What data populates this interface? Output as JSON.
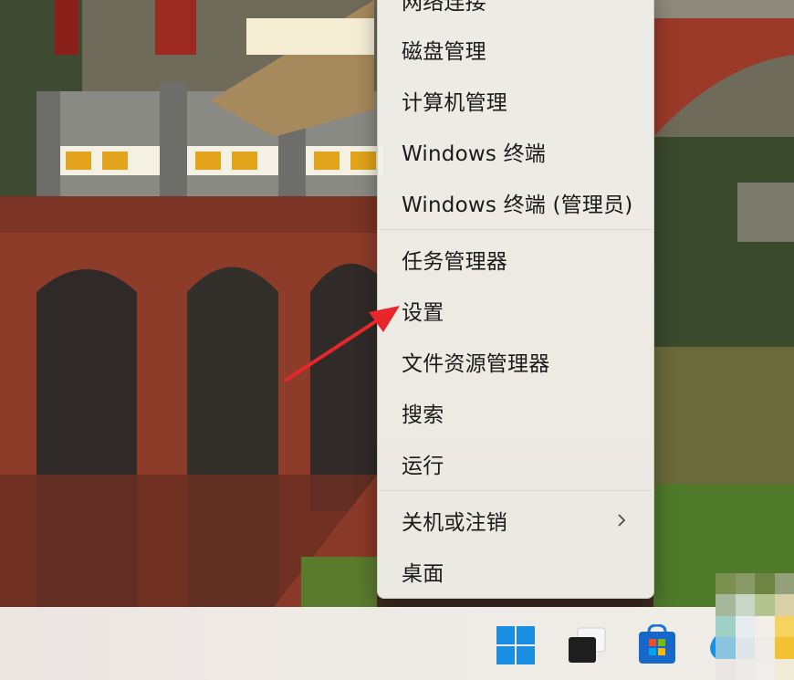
{
  "context_menu": {
    "items": [
      {
        "label": "网络连接"
      },
      {
        "label": "磁盘管理"
      },
      {
        "label": "计算机管理"
      },
      {
        "label": "Windows 终端"
      },
      {
        "label": "Windows 终端 (管理员)"
      },
      {
        "label": "任务管理器"
      },
      {
        "label": "设置"
      },
      {
        "label": "文件资源管理器"
      },
      {
        "label": "搜索"
      },
      {
        "label": "运行"
      },
      {
        "label": "关机或注销",
        "has_submenu": true
      },
      {
        "label": "桌面"
      }
    ]
  },
  "annotation": {
    "color": "#e8272a",
    "points_to": "设置"
  },
  "taskbar": {
    "icons": [
      "windows-start-icon",
      "task-view-icon",
      "microsoft-store-icon",
      "edge-icon"
    ]
  },
  "colors": {
    "menu_bg": "#f1f0e9",
    "win_blue": "#1a8ee0",
    "arrow_red": "#e8272a"
  }
}
